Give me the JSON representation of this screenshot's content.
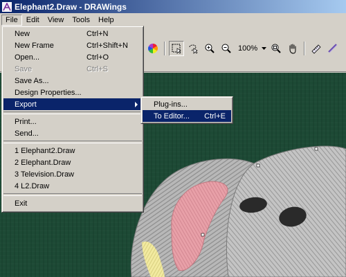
{
  "window": {
    "title": "Elephant2.Draw - DRAWings"
  },
  "menubar": {
    "items": [
      {
        "label": "File"
      },
      {
        "label": "Edit"
      },
      {
        "label": "View"
      },
      {
        "label": "Tools"
      },
      {
        "label": "Help"
      }
    ]
  },
  "toolbar": {
    "zoom_value": "100%"
  },
  "file_menu": {
    "new": {
      "label": "New",
      "shortcut": "Ctrl+N"
    },
    "new_frame": {
      "label": "New Frame",
      "shortcut": "Ctrl+Shift+N"
    },
    "open": {
      "label": "Open...",
      "shortcut": "Ctrl+O"
    },
    "save": {
      "label": "Save",
      "shortcut": "Ctrl+S"
    },
    "save_as": {
      "label": "Save As..."
    },
    "design_properties": {
      "label": "Design Properties..."
    },
    "export": {
      "label": "Export"
    },
    "print": {
      "label": "Print..."
    },
    "send": {
      "label": "Send..."
    },
    "recent": [
      {
        "label": "1 Elephant2.Draw"
      },
      {
        "label": "2 Elephant.Draw"
      },
      {
        "label": "3 Television.Draw"
      },
      {
        "label": "4 L2.Draw"
      }
    ],
    "exit": {
      "label": "Exit"
    }
  },
  "export_menu": {
    "plugins": {
      "label": "Plug-ins..."
    },
    "to_editor": {
      "label": "To Editor...",
      "shortcut": "Ctrl+E"
    }
  },
  "colors": {
    "title_bar": "#0a246a",
    "menu_highlight": "#0a246a",
    "canvas_background": "#1d4a35",
    "elephant_body": "#b8b8b8",
    "ear_pink": "#e8a0a8"
  }
}
